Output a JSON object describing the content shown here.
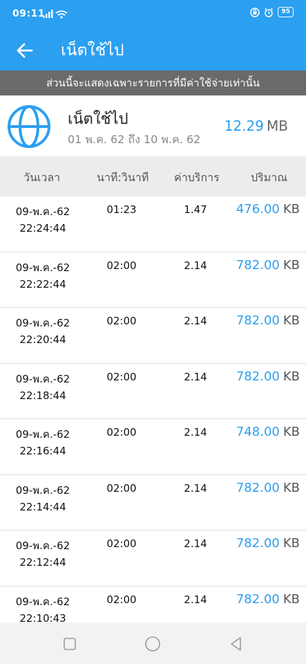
{
  "status": {
    "time": "09:11",
    "battery": "95",
    "icons": [
      "signal-icon",
      "wifi-icon",
      "lock-icon",
      "alarm-icon",
      "battery-icon"
    ]
  },
  "app_bar": {
    "title": "เน็ตใช้ไป"
  },
  "notice": "ส่วนนี้จะแสดงเฉพาะรายการที่มีค่าใช้จ่ายเท่านั้น",
  "summary": {
    "name": "เน็ตใช้ไป",
    "date_range": "01 พ.ค. 62 ถึง 10 พ.ค. 62",
    "total_value": "12.29",
    "total_unit": "MB"
  },
  "table": {
    "headers": [
      "วันเวลา",
      "นาที:วินาที",
      "ค่าบริการ",
      "ปริมาณ"
    ],
    "rows": [
      {
        "date": "09-พ.ค.-62",
        "time": "22:24:44",
        "duration": "01:23",
        "fee": "1.47",
        "amount": "476.00",
        "unit": "KB"
      },
      {
        "date": "09-พ.ค.-62",
        "time": "22:22:44",
        "duration": "02:00",
        "fee": "2.14",
        "amount": "782.00",
        "unit": "KB"
      },
      {
        "date": "09-พ.ค.-62",
        "time": "22:20:44",
        "duration": "02:00",
        "fee": "2.14",
        "amount": "782.00",
        "unit": "KB"
      },
      {
        "date": "09-พ.ค.-62",
        "time": "22:18:44",
        "duration": "02:00",
        "fee": "2.14",
        "amount": "782.00",
        "unit": "KB"
      },
      {
        "date": "09-พ.ค.-62",
        "time": "22:16:44",
        "duration": "02:00",
        "fee": "2.14",
        "amount": "748.00",
        "unit": "KB"
      },
      {
        "date": "09-พ.ค.-62",
        "time": "22:14:44",
        "duration": "02:00",
        "fee": "2.14",
        "amount": "782.00",
        "unit": "KB"
      },
      {
        "date": "09-พ.ค.-62",
        "time": "22:12:44",
        "duration": "02:00",
        "fee": "2.14",
        "amount": "782.00",
        "unit": "KB"
      },
      {
        "date": "09-พ.ค.-62",
        "time": "22:10:43",
        "duration": "02:00",
        "fee": "2.14",
        "amount": "782.00",
        "unit": "KB"
      }
    ]
  },
  "colors": {
    "accent": "#2b9ff0",
    "notice_bg": "#6a6a6a",
    "header_bg": "#ececec"
  }
}
